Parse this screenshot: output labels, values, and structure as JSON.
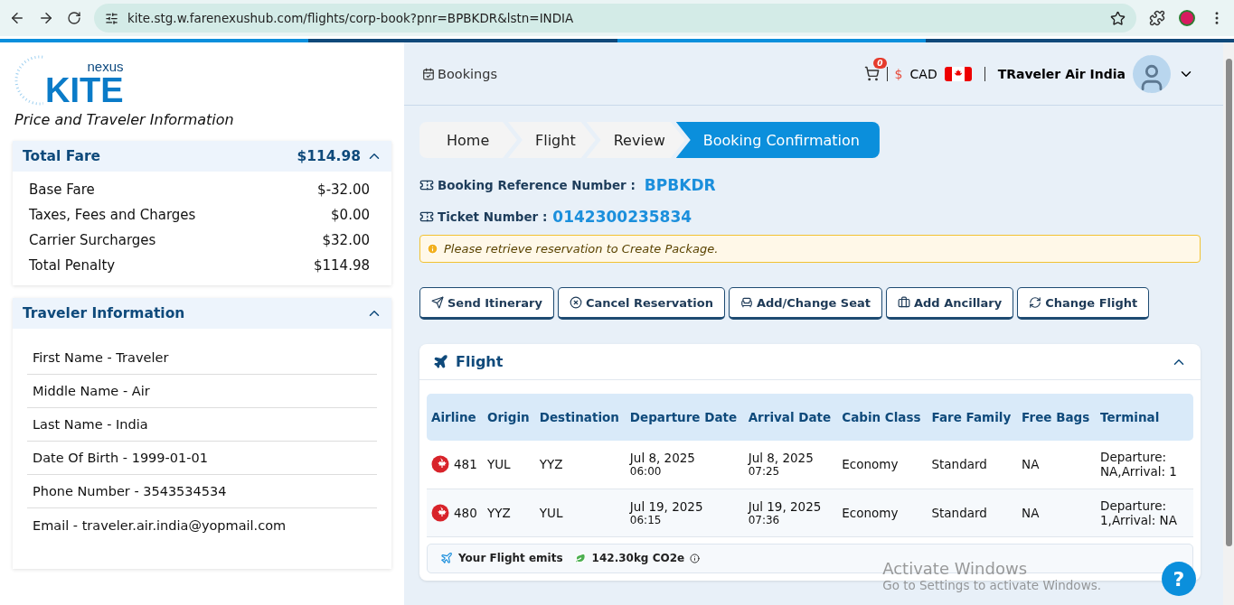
{
  "browser": {
    "url": "kite.stg.w.farenexushub.com/flights/corp-book?pnr=BPBKDR&lstn=INDIA"
  },
  "logo": {
    "small": "nexus",
    "big": "KITE"
  },
  "sidebar": {
    "title": "Price and Traveler Information",
    "fare": {
      "title": "Total Fare",
      "total": "$114.98",
      "expanded": true,
      "rows": [
        {
          "label": "Base Fare",
          "value": "$-32.00"
        },
        {
          "label": "Taxes, Fees and Charges",
          "value": "$0.00"
        },
        {
          "label": "Carrier Surcharges",
          "value": "$32.00"
        },
        {
          "label": "Total Penalty",
          "value": "$114.98"
        }
      ]
    },
    "traveler": {
      "title": "Traveler Information",
      "expanded": true,
      "rows": [
        "First Name - Traveler",
        "Middle Name - Air",
        "Last Name - India",
        "Date Of Birth - 1999-01-01",
        "Phone Number - 3543534534",
        "Email - traveler.air.india@yopmail.com"
      ]
    }
  },
  "header": {
    "bookings": "Bookings",
    "cart_count": "0",
    "currency_symbol": "$",
    "currency": "CAD",
    "user": "TRaveler Air India"
  },
  "breadcrumbs": [
    {
      "label": "Home",
      "selected": false
    },
    {
      "label": "Flight",
      "selected": false
    },
    {
      "label": "Review",
      "selected": false
    },
    {
      "label": "Booking Confirmation",
      "selected": true
    }
  ],
  "booking_reference": {
    "label": "Booking Reference Number :",
    "value": "BPBKDR"
  },
  "ticket": {
    "label": "Ticket Number :",
    "value": "0142300235834"
  },
  "alert": "Please retrieve reservation to Create Package.",
  "actions": [
    {
      "kind": "send",
      "label": "Send Itinerary"
    },
    {
      "kind": "cancel",
      "label": "Cancel Reservation"
    },
    {
      "kind": "seat",
      "label": "Add/Change Seat"
    },
    {
      "kind": "ancillary",
      "label": "Add Ancillary"
    },
    {
      "kind": "change",
      "label": "Change Flight"
    }
  ],
  "flight": {
    "title": "Flight",
    "expanded": true,
    "columns": [
      "Airline",
      "Origin",
      "Destination",
      "Departure Date",
      "Arrival Date",
      "Cabin Class",
      "Fare Family",
      "Free Bags",
      "Terminal"
    ],
    "rows": [
      {
        "flight_no": "481",
        "origin": "YUL",
        "destination": "YYZ",
        "dep_date": "Jul 8, 2025",
        "dep_time": "06:00",
        "arr_date": "Jul 8, 2025",
        "arr_time": "07:25",
        "cabin": "Economy",
        "fare_family": "Standard",
        "bags": "NA",
        "terminal": "Departure: NA,Arrival: 1"
      },
      {
        "flight_no": "480",
        "origin": "YYZ",
        "destination": "YUL",
        "dep_date": "Jul 19, 2025",
        "dep_time": "06:15",
        "arr_date": "Jul 19, 2025",
        "arr_time": "07:36",
        "cabin": "Economy",
        "fare_family": "Standard",
        "bags": "NA",
        "terminal": "Departure: 1,Arrival: NA"
      }
    ],
    "emissions_label": "Your Flight emits",
    "emissions_value": "142.30kg CO2e"
  },
  "os_overlay": {
    "title": "Activate Windows",
    "subtitle": "Go to Settings to activate Windows."
  },
  "help": "?"
}
